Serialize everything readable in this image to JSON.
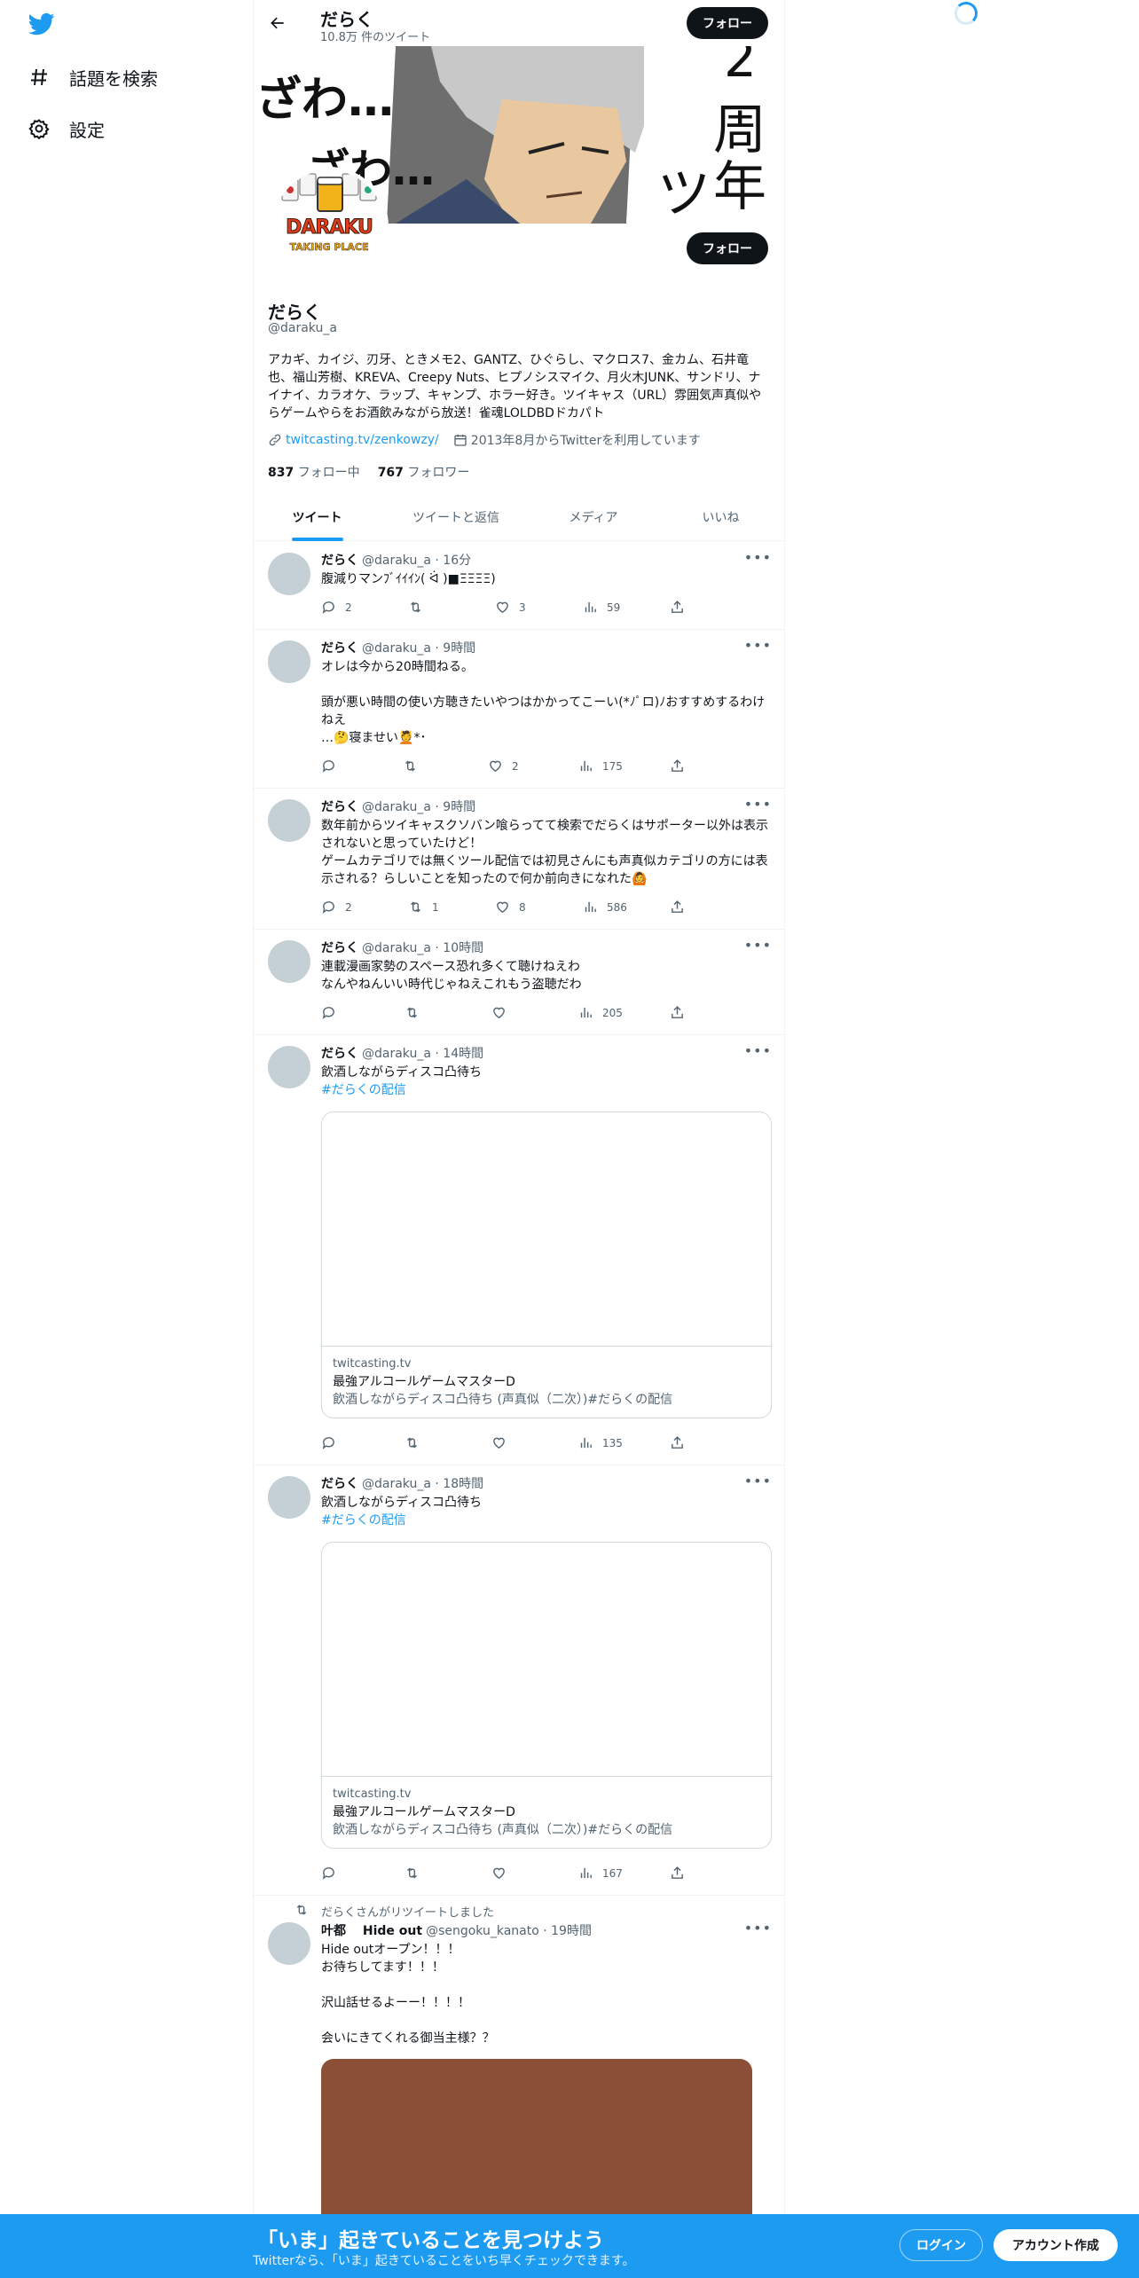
{
  "colors": {
    "accent": "#1d9bf0",
    "dark": "#0f1419",
    "muted": "#536471"
  },
  "nav": {
    "explore": "話題を検索",
    "settings": "設定"
  },
  "header": {
    "title": "だらく",
    "subtitle": "10.8万 件のツイート",
    "follow": "フォロー"
  },
  "banner": {
    "text1": "ざわ…",
    "text2": "ざわ…",
    "text3": "2",
    "text4": "周",
    "text5": "年",
    "text6": "ツ"
  },
  "avatar": {
    "line1": "DARAKU",
    "line2": "TAKING PLACE"
  },
  "profile": {
    "name": "だらく",
    "handle": "@daraku_a",
    "follow_button": "フォロー",
    "bio": "アカギ、カイジ、刃牙、ときメモ2、GANTZ、ひぐらし、マクロス7、金カム、石井竜也、福山芳樹、KREVA、Creepy Nuts、ヒプノシスマイク、月火木JUNK、サンドリ、ナイナイ、カラオケ、ラップ、キャンプ、ホラー好き。ツイキャス（URL）雰囲気声真似やらゲームやらをお酒飲みながら放送！雀魂LOLDBDドカパト",
    "link": "twitcasting.tv/zenkowzy/",
    "joined": "2013年8月からTwitterを利用しています",
    "following_count": "837",
    "following_label": "フォロー中",
    "followers_count": "767",
    "followers_label": "フォロワー"
  },
  "tabs": [
    "ツイート",
    "ツイートと返信",
    "メディア",
    "いいね"
  ],
  "tweets": [
    {
      "name": "だらく",
      "meta": "@daraku_a · 16分",
      "text": "腹減りマンﾌﾞｲｲｲﾝ( ᐛ )■ΞΞΞΞ)",
      "reply": "2",
      "retweet": "",
      "like": "3",
      "views": "59"
    },
    {
      "name": "だらく",
      "meta": "@daraku_a · 9時間",
      "text": "オレは今から20時間ねる。\n\n頭が悪い時間の使い方聴きたいやつはかかってこーい(*ﾉﾟロ)ﾉおすすめするわけねえ\n…🤔寝ませい💆*･",
      "reply": "",
      "retweet": "",
      "like": "2",
      "views": "175"
    },
    {
      "name": "だらく",
      "meta": "@daraku_a · 9時間",
      "text": "数年前からツイキャスクソバン喰らってて検索でだらくはサポーター以外は表示されないと思っていたけど！\nゲームカテゴリでは無くツール配信では初見さんにも声真似カテゴリの方には表示される？らしいことを知ったので何か前向きになれた🙆",
      "reply": "2",
      "retweet": "1",
      "like": "8",
      "views": "586"
    },
    {
      "name": "だらく",
      "meta": "@daraku_a · 10時間",
      "text": "連載漫画家勢のスペース恐れ多くて聴けねえわ\nなんやねんいい時代じゃねえこれもう盗聴だわ",
      "reply": "",
      "retweet": "",
      "like": "",
      "views": "205"
    },
    {
      "name": "だらく",
      "meta": "@daraku_a · 14時間",
      "text": "飲酒しながらディスコ凸待ち",
      "hashtag": "#だらくの配信",
      "card_domain": "twitcasting.tv",
      "card_title": "最強アルコールゲームマスターD",
      "card_desc": "飲酒しながらディスコ凸待ち (声真似（二次）)#だらくの配信",
      "reply": "",
      "retweet": "",
      "like": "",
      "views": "135"
    },
    {
      "name": "だらく",
      "meta": "@daraku_a · 18時間",
      "text": "飲酒しながらディスコ凸待ち",
      "hashtag": "#だらくの配信",
      "card_domain": "twitcasting.tv",
      "card_title": "最強アルコールゲームマスターD",
      "card_desc": "飲酒しながらディスコ凸待ち (声真似（二次）)#だらくの配信",
      "reply": "",
      "retweet": "",
      "like": "",
      "views": "167"
    }
  ],
  "retweet": {
    "label": "だらくさんがリツイートしました",
    "name": "叶都　 Hide out",
    "meta": "@sengoku_kanato · 19時間",
    "text": "Hide outオープン！！！\nお待ちしてます！！！\n\n沢山話せるよーー！！！！\n\n会いにきてくれる御当主様？？"
  },
  "bottom": {
    "title": "「いま」起きていることを見つけよう",
    "subtitle": "Twitterなら、「いま」起きていることをいち早くチェックできます。",
    "login": "ログイン",
    "signup": "アカウント作成"
  }
}
